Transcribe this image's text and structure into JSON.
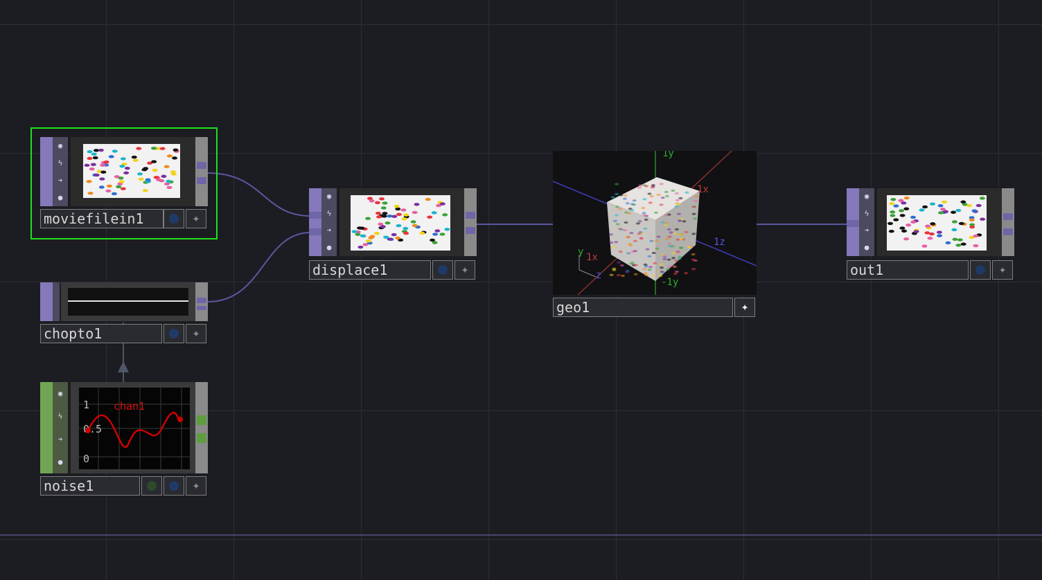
{
  "app": "TouchDesigner network editor",
  "colors": {
    "background": "#1c1d22",
    "top_connector": "#8579bb",
    "chop_connector": "#70a653",
    "selection": "#1ee21a",
    "wire": "#5a58a0"
  },
  "nodes": {
    "moviefilein1": {
      "label": "moviefilein1",
      "type": "TOP",
      "selected": true
    },
    "chopto1": {
      "label": "chopto1",
      "type": "TOP"
    },
    "noise1": {
      "label": "noise1",
      "type": "CHOP",
      "graph": {
        "channel": "chan1",
        "ticks": [
          "1",
          "0.5",
          "0"
        ]
      }
    },
    "displace1": {
      "label": "displace1",
      "type": "TOP"
    },
    "geo1": {
      "label": "geo1",
      "type": "COMP",
      "axes": {
        "x": "1x",
        "y": "1y",
        "z": "1z",
        "neg_y": "-1y",
        "left_x": "1x",
        "left_y": "y",
        "left_z": "z"
      }
    },
    "out1": {
      "label": "out1",
      "type": "TOP"
    }
  },
  "icons": {
    "viewer_flag": "eye-icon",
    "bypass": "lightning-icon",
    "cook": "arrow-right-icon",
    "lock": "lock-icon",
    "add": "sparkle-plus-icon"
  }
}
